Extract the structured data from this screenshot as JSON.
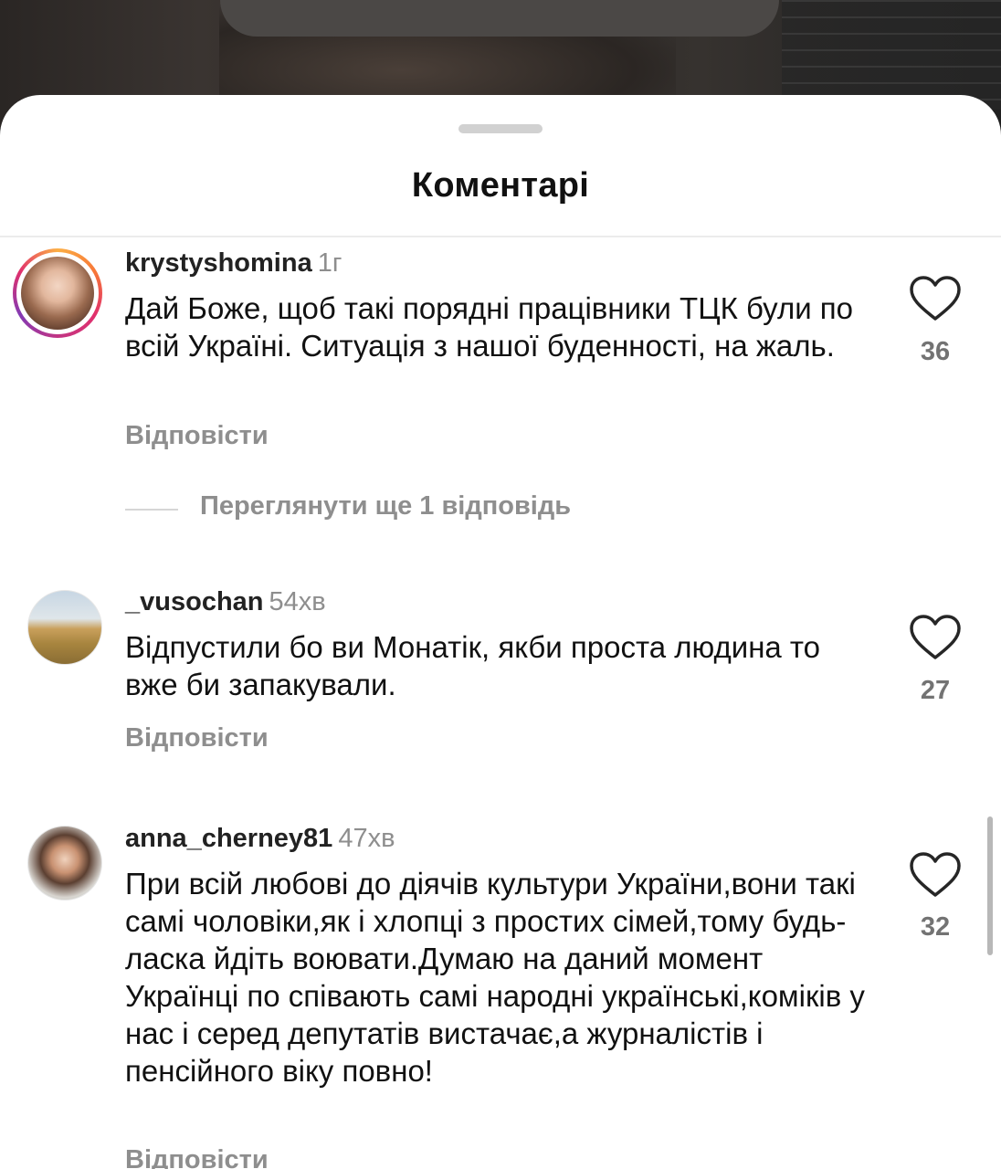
{
  "sheet": {
    "title": "Коментарі"
  },
  "comments": [
    {
      "username": "krystyshomina",
      "time": "1г",
      "text": "Дай Боже, щоб такі порядні працівники ТЦК були по всій Україні. Ситуація з нашої буденності, на жаль.",
      "reply_label": "Відповісти",
      "likes": "36",
      "more_replies": "Переглянути ще 1 відповідь"
    },
    {
      "username": "_vusochan",
      "time": "54хв",
      "text": "Відпустили бо ви Монатік, якби проста людина то вже би запакували.",
      "reply_label": "Відповісти",
      "likes": "27"
    },
    {
      "username": "anna_cherney81",
      "time": "47хв",
      "text": "При всій любові до діячів культури України,вони такі самі чоловіки,як і хлопці з простих сімей,тому будь-ласка йдіть воювати.Думаю на даний момент Українці по співають самі народні українські,коміків у нас і серед депутатів вистачає,а журналістів і пенсійного віку повно!",
      "reply_label": "Відповісти",
      "likes": "32"
    }
  ],
  "icons": {
    "like": "heart-outline-icon",
    "drag": "drag-handle"
  },
  "colors": {
    "muted": "#8e8e8e",
    "text": "#111111",
    "story_ring": "#e1306c"
  }
}
